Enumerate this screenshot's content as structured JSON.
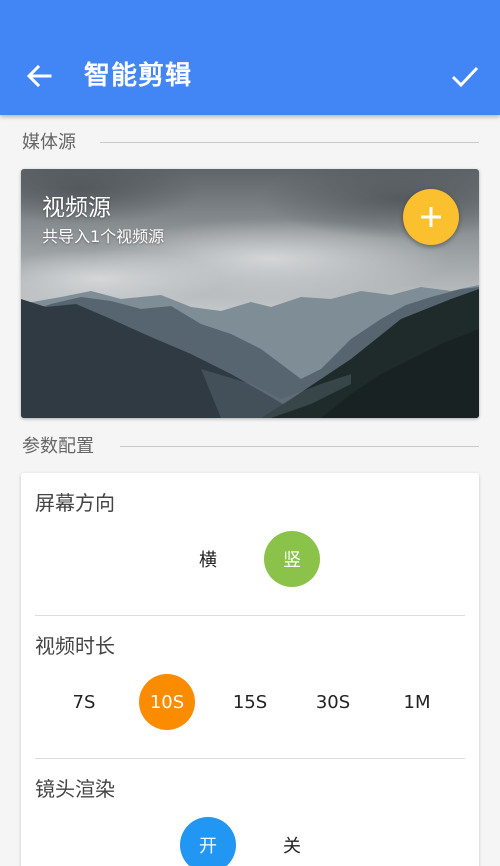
{
  "appbar": {
    "title": "智能剪辑",
    "back_icon": "arrow-left-icon",
    "confirm_icon": "checkmark-icon",
    "color": "#4285f4"
  },
  "media_section": {
    "label": "媒体源",
    "card": {
      "title": "视频源",
      "subtitle": "共导入1个视频源",
      "add_icon": "plus-icon",
      "fab_color": "#fbc02d"
    }
  },
  "config_section": {
    "label": "参数配置",
    "screen_orientation": {
      "title": "屏幕方向",
      "options": [
        "横",
        "竖"
      ],
      "selected": "竖",
      "selected_color": "#8bc34a"
    },
    "video_duration": {
      "title": "视频时长",
      "options": [
        "7S",
        "10S",
        "15S",
        "30S",
        "1M"
      ],
      "selected": "10S",
      "selected_color": "#fb8c00"
    },
    "lens_render": {
      "title": "镜头渲染",
      "options": [
        "开",
        "关"
      ],
      "selected": "开",
      "selected_color": "#2196f3"
    }
  }
}
